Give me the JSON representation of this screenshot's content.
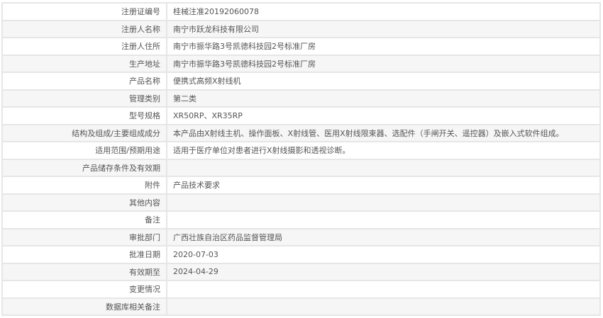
{
  "rows": [
    {
      "label": "注册证编号",
      "value": "桂械注准20192060078"
    },
    {
      "label": "注册人名称",
      "value": "南宁市跃龙科技有限公司"
    },
    {
      "label": "注册人住所",
      "value": "南宁市振华路3号凯德科技园2号标准厂房"
    },
    {
      "label": "生产地址",
      "value": "南宁市振华路3号凯德科技园2号标准厂房"
    },
    {
      "label": "产品名称",
      "value": "便携式高频X射线机"
    },
    {
      "label": "管理类别",
      "value": "第二类"
    },
    {
      "label": "型号规格",
      "value": "XR50RP、XR35RP"
    },
    {
      "label": "结构及组成/主要组成成分",
      "value": "本产品由X射线主机、操作面板、X射线管、医用X射线限束器、选配件（手闸开关、遥控器）及嵌入式软件组成。"
    },
    {
      "label": "适用范围/预期用途",
      "value": "适用于医疗单位对患者进行X射线摄影和透视诊断。"
    },
    {
      "label": "产品储存条件及有效期",
      "value": ""
    },
    {
      "label": "附件",
      "value": "产品技术要求"
    },
    {
      "label": "其他内容",
      "value": ""
    },
    {
      "label": "备注",
      "value": ""
    },
    {
      "label": "审批部门",
      "value": "广西壮族自治区药品监督管理局"
    },
    {
      "label": "批准日期",
      "value": "2020-07-03"
    },
    {
      "label": "有效期至",
      "value": "2024-04-29"
    },
    {
      "label": "变更情况",
      "value": ""
    },
    {
      "label": "数据库相关备注",
      "value": ""
    }
  ]
}
